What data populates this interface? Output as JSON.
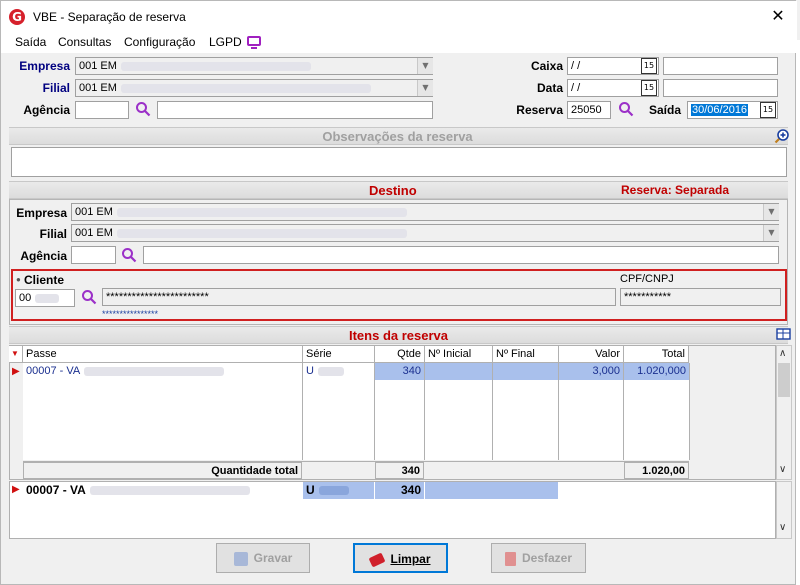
{
  "window": {
    "title": "VBE - Separação de reserva",
    "close_glyph": "✕",
    "logo_letter": "G"
  },
  "menu": [
    {
      "label": "Saída"
    },
    {
      "label": "Consultas"
    },
    {
      "label": "Configuração"
    },
    {
      "label": "LGPD"
    }
  ],
  "header": {
    "empresa_label": "Empresa",
    "empresa_value": "001 EM",
    "filial_label": "Filial",
    "filial_value": "001 EM",
    "agencia_label": "Agência",
    "caixa_label": "Caixa",
    "caixa_value": "/ /",
    "data_label": "Data",
    "data_value": "/ /",
    "reserva_label": "Reserva",
    "reserva_value": "25050",
    "saida_label": "Saída",
    "saida_value": "30/06/2016"
  },
  "observacoes": {
    "title": "Observações da reserva"
  },
  "destino": {
    "title": "Destino",
    "status": "Reserva: Separada",
    "empresa_label": "Empresa",
    "empresa_value": "001 EM",
    "filial_label": "Filial",
    "filial_value": "001 EM",
    "agencia_label": "Agência",
    "cliente_label": "Cliente",
    "cliente_value": "00",
    "cliente_name": "************************",
    "cliente_link": "****************",
    "cpf_label": "CPF/CNPJ",
    "cpf_value": "***********"
  },
  "itens": {
    "title": "Itens da reserva",
    "columns": [
      "Passe",
      "Série",
      "Qtde",
      "Nº Inicial",
      "Nº Final",
      "Valor",
      "Total"
    ],
    "rows": [
      {
        "passe": "00007 - VA",
        "serie": "U",
        "qtde": "340",
        "inicial": "",
        "final": "",
        "valor": "3,000",
        "total": "1.020,000"
      }
    ],
    "total_label": "Quantidade total",
    "total_qtde": "340",
    "total_valor": "1.020,00",
    "summary": {
      "passe": "00007 - VA",
      "serie": "U",
      "qtde": "340"
    }
  },
  "buttons": {
    "gravar": "Gravar",
    "limpar": "Limpar",
    "desfazer": "Desfazer"
  },
  "colors": {
    "label_blue": "#000080",
    "section_red": "#c00000",
    "highlight_row": "#a9c0ec",
    "cliente_border": "#d02020"
  }
}
